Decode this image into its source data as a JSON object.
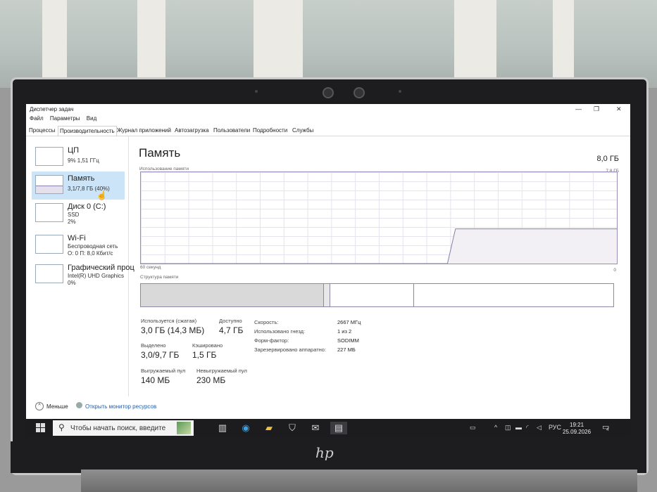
{
  "window": {
    "title": "Диспетчер задач",
    "menu": [
      "Файл",
      "Параметры",
      "Вид"
    ],
    "tabs": [
      "Процессы",
      "Производительность",
      "Журнал приложений",
      "Автозагрузка",
      "Пользователи",
      "Подробности",
      "Службы"
    ],
    "active_tab": "Производительность"
  },
  "sidebar": {
    "items": [
      {
        "title": "ЦП",
        "line1": "9%  1,51 ГГц",
        "line2": ""
      },
      {
        "title": "Память",
        "line1": "3,1/7,8 ГБ (40%)",
        "line2": ""
      },
      {
        "title": "Диск 0 (C:)",
        "line1": "SSD",
        "line2": "2%"
      },
      {
        "title": "Wi-Fi",
        "line1": "Беспроводная сеть",
        "line2": "О: 0  П: 8,0 Кбит/с"
      },
      {
        "title": "Графический проц",
        "line1": "Intel(R) UHD Graphics",
        "line2": "0%"
      }
    ]
  },
  "memory": {
    "heading": "Память",
    "total": "8,0 ГБ",
    "usage_label": "Использование памяти",
    "usage_max": "7,8 ГБ",
    "time_label": "60 секунд",
    "zero_label": "0",
    "structure_label": "Структура памяти",
    "usage_history_fraction": [
      0,
      0,
      0,
      0,
      0,
      0,
      0,
      0,
      0,
      0,
      0,
      0,
      0,
      0,
      0,
      0,
      0,
      0,
      0,
      0,
      0,
      0,
      0,
      0,
      0,
      0,
      0,
      0,
      0,
      0,
      0,
      0,
      0,
      0,
      0,
      0,
      0,
      0,
      0,
      0.38,
      0.38,
      0.38,
      0.38,
      0.38,
      0.38,
      0.38,
      0.38,
      0.38,
      0.38,
      0.38,
      0.38,
      0.38,
      0.38,
      0.38,
      0.38,
      0.38,
      0.38,
      0.38,
      0.38,
      0.38
    ],
    "stats": {
      "in_use_label": "Используется (сжатая)",
      "in_use": "3,0 ГБ (14,3 МБ)",
      "available_label": "Доступно",
      "available": "4,7 ГБ",
      "committed_label": "Выделено",
      "committed": "3,0/9,7 ГБ",
      "cached_label": "Кэшировано",
      "cached": "1,5 ГБ",
      "paged_label": "Выгружаемый пул",
      "paged": "140 МБ",
      "nonpaged_label": "Невыгружаемый пул",
      "nonpaged": "230 МБ"
    },
    "props": [
      {
        "label": "Скорость:",
        "value": "2667 МГц"
      },
      {
        "label": "Использовано гнезд:",
        "value": "1 из 2"
      },
      {
        "label": "Форм-фактор:",
        "value": "SODIMM"
      },
      {
        "label": "Зарезервировано аппаратно:",
        "value": "227 МБ"
      }
    ]
  },
  "footer": {
    "less": "Меньше",
    "resmon": "Открыть монитор ресурсов"
  },
  "taskbar": {
    "search_placeholder": "Чтобы начать поиск, введите",
    "lang": "РУС",
    "time": "19:21",
    "date": "25.09.2026",
    "notifications": "4"
  },
  "colors": {
    "graph_line": "#8b7ea8",
    "graph_fill": "#f2f0f5",
    "selected": "#cce4f7",
    "taskbar": "#1c1c1f"
  }
}
